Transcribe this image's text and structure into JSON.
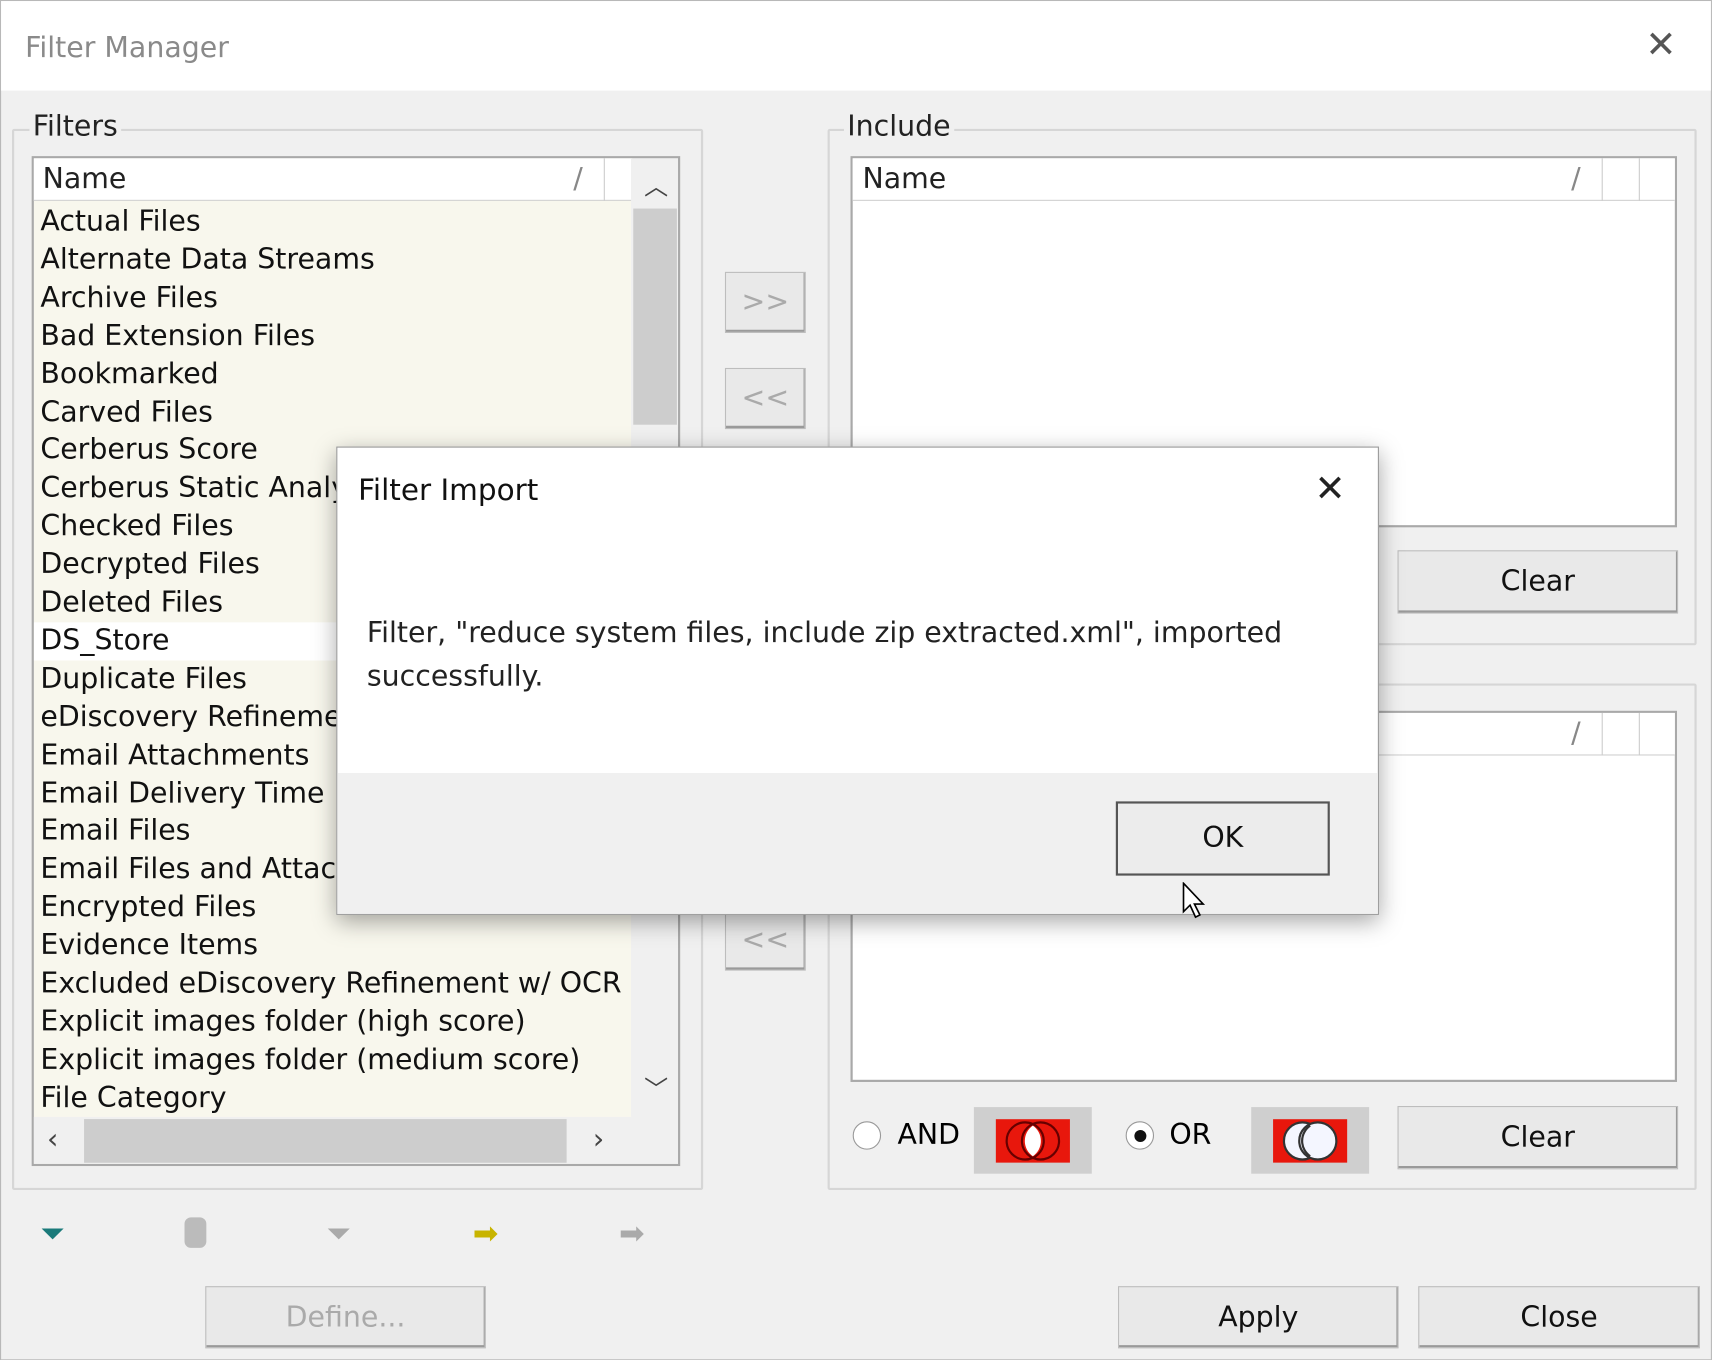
{
  "window": {
    "title": "Filter Manager",
    "close_icon": "close-icon"
  },
  "filters": {
    "label": "Filters",
    "column": "Name",
    "sort_indicator": "/",
    "items": [
      "Actual Files",
      "Alternate Data Streams",
      "Archive Files",
      "Bad Extension Files",
      "Bookmarked",
      "Carved Files",
      "Cerberus Score",
      "Cerberus Static Analysis",
      "Checked Files",
      "Decrypted Files",
      "Deleted Files",
      "DS_Store",
      "Duplicate Files",
      "eDiscovery Refinement",
      "Email Attachments",
      "Email Delivery Time",
      "Email Files",
      "Email Files and Attachments",
      "Encrypted Files",
      "Evidence Items",
      "Excluded eDiscovery Refinement w/ OCR",
      "Explicit images folder (high score)",
      "Explicit images folder (medium score)",
      "File Category"
    ],
    "selected": "DS_Store"
  },
  "arrows": {
    "add": ">>",
    "remove": "<<"
  },
  "include": {
    "label": "Include",
    "column": "Name",
    "sort_indicator": "/",
    "clear": "Clear"
  },
  "exclude": {
    "sort_indicator": "/",
    "clear": "Clear"
  },
  "logic": {
    "and": "AND",
    "or": "OR",
    "selected": "OR",
    "accent": "#e8170c"
  },
  "toolbar": {
    "icons": [
      "new-filter-icon",
      "delete-icon",
      "edit-filter-icon",
      "import-filter-icon",
      "export-filter-icon"
    ]
  },
  "buttons": {
    "define": "Define...",
    "apply": "Apply",
    "close": "Close"
  },
  "dialog": {
    "title": "Filter Import",
    "message": "Filter, \"reduce system files, include zip extracted.xml\", imported successfully.",
    "ok": "OK"
  }
}
